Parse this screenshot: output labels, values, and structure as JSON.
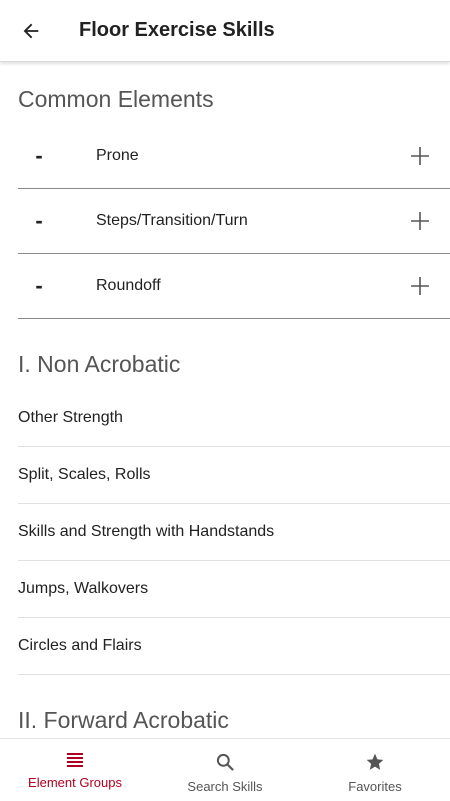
{
  "appbar": {
    "title": "Floor Exercise Skills",
    "back_icon": "arrow-left-icon"
  },
  "common": {
    "heading": "Common Elements",
    "items": [
      {
        "dash": "-",
        "label": "Prone"
      },
      {
        "dash": "-",
        "label": "Steps/Transition/Turn"
      },
      {
        "dash": "-",
        "label": "Roundoff"
      }
    ]
  },
  "non_acrobatic": {
    "heading": "I. Non Acrobatic",
    "items": [
      "Other Strength",
      "Split, Scales, Rolls",
      "Skills and Strength with Handstands",
      "Jumps, Walkovers",
      "Circles and Flairs"
    ]
  },
  "forward_acrobatic": {
    "heading": "II. Forward Acrobatic"
  },
  "bottom_nav": [
    {
      "label": "Element Groups",
      "icon": "list-icon",
      "active": true
    },
    {
      "label": "Search Skills",
      "icon": "search-icon",
      "active": false
    },
    {
      "label": "Favorites",
      "icon": "star-icon",
      "active": false
    }
  ],
  "colors": {
    "accent": "#b00020",
    "icon_gray": "#555555",
    "divider": "#8a8a8a"
  }
}
